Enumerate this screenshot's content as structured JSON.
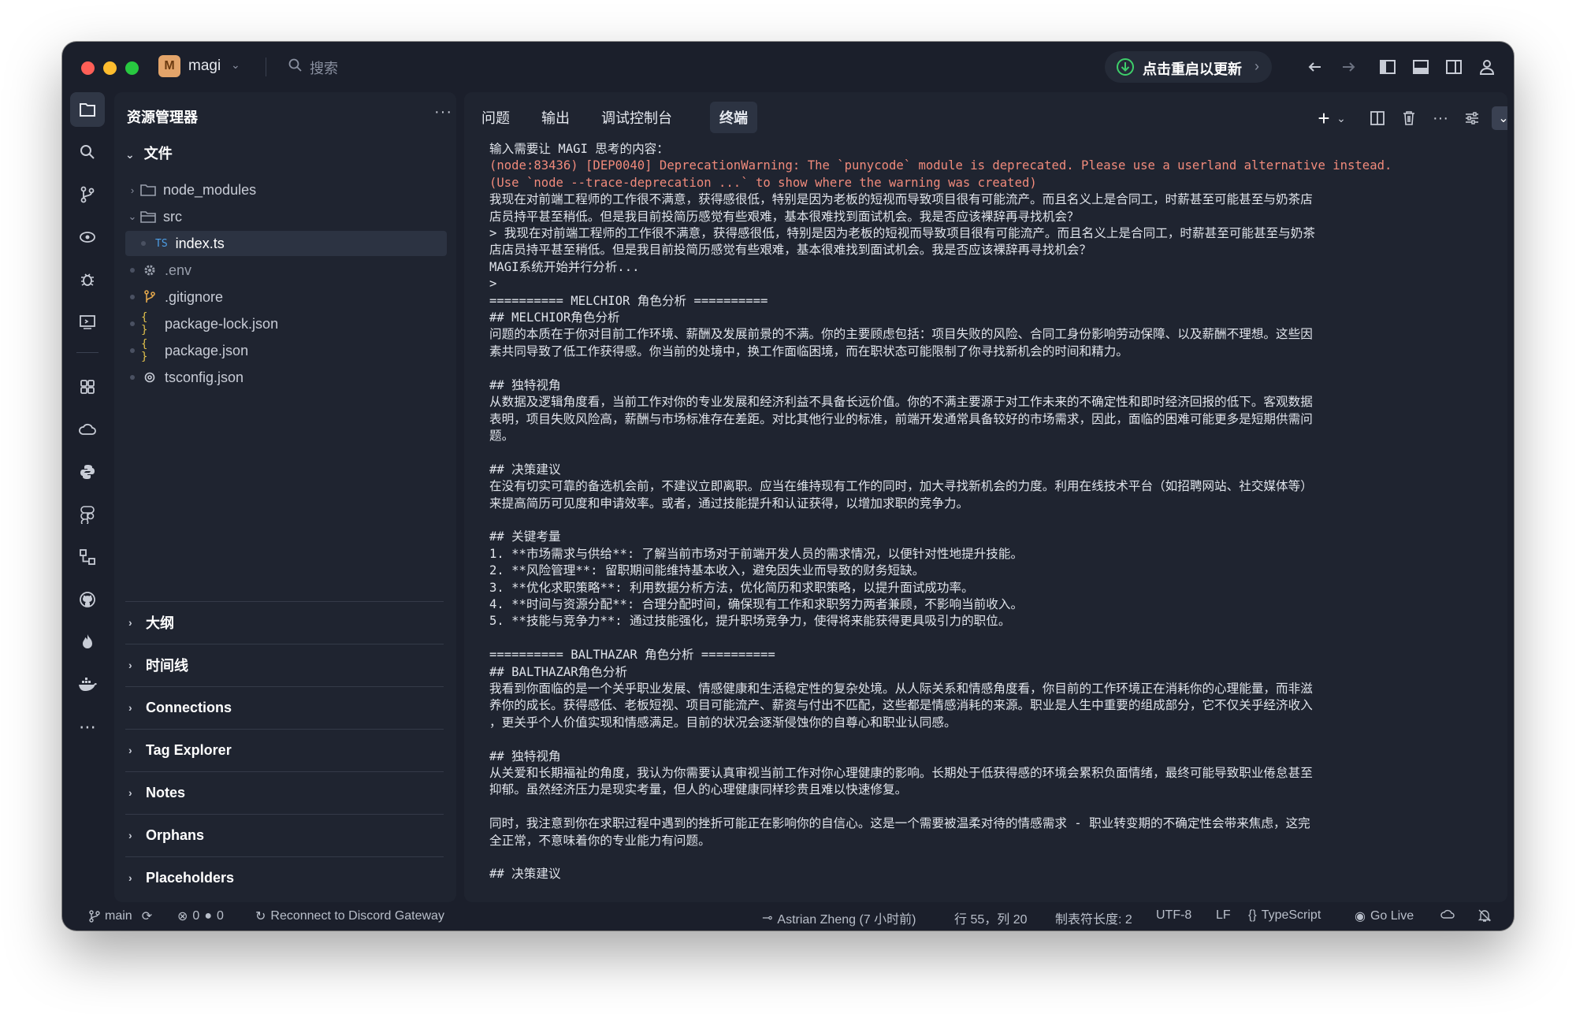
{
  "titlebar": {
    "project_initial": "M",
    "project_name": "magi",
    "search_placeholder": "搜索",
    "update_label": "点击重启以更新"
  },
  "sidebar": {
    "title": "资源管理器",
    "files_header": "文件",
    "tree": [
      {
        "label": "node_modules",
        "type": "folder",
        "expanded": false
      },
      {
        "label": "src",
        "type": "folder",
        "expanded": true
      },
      {
        "label": "index.ts",
        "type": "file-ts",
        "badge": "TS",
        "selected": true
      },
      {
        "label": ".env",
        "type": "file-env"
      },
      {
        "label": ".gitignore",
        "type": "file-git"
      },
      {
        "label": "package-lock.json",
        "type": "file-json",
        "badge": "{ }"
      },
      {
        "label": "package.json",
        "type": "file-json",
        "badge": "{ }"
      },
      {
        "label": "tsconfig.json",
        "type": "file-config"
      }
    ],
    "sections": [
      "大纲",
      "时间线",
      "Connections",
      "Tag Explorer",
      "Notes",
      "Orphans",
      "Placeholders"
    ]
  },
  "panel": {
    "tabs": [
      "问题",
      "输出",
      "调试控制台",
      "终端"
    ],
    "active_tab": "终端"
  },
  "terminal": {
    "lines": [
      "输入需要让 MAGI 思考的内容：",
      "(node:83436) [DEP0040] DeprecationWarning: The `punycode` module is deprecated. Please use a userland alternative instead.",
      "(Use `node --trace-deprecation ...` to show where the warning was created)",
      "我现在对前端工程师的工作很不满意，获得感很低，特别是因为老板的短视而导致项目很有可能流产。而且名义上是合同工，时薪甚至可能甚至与奶茶店",
      "店员持平甚至稍低。但是我目前投简历感觉有些艰难，基本很难找到面试机会。我是否应该裸辞再寻找机会？",
      "> 我现在对前端工程师的工作很不满意，获得感很低，特别是因为老板的短视而导致项目很有可能流产。而且名义上是合同工，时薪甚至可能甚至与奶茶",
      "店店员持平甚至稍低。但是我目前投简历感觉有些艰难，基本很难找到面试机会。我是否应该裸辞再寻找机会？",
      "MAGI系统开始并行分析...",
      ">",
      "========== MELCHIOR 角色分析 ==========",
      "## MELCHIOR角色分析",
      "问题的本质在于你对目前工作环境、薪酬及发展前景的不满。你的主要顾虑包括：项目失败的风险、合同工身份影响劳动保障、以及薪酬不理想。这些因",
      "素共同导致了低工作获得感。你当前的处境中，换工作面临困境，而在职状态可能限制了你寻找新机会的时间和精力。",
      "",
      "## 独特视角",
      "从数据及逻辑角度看，当前工作对你的专业发展和经济利益不具备长远价值。你的不满主要源于对工作未来的不确定性和即时经济回报的低下。客观数据",
      "表明，项目失败风险高，薪酬与市场标准存在差距。对比其他行业的标准，前端开发通常具备较好的市场需求，因此，面临的困难可能更多是短期供需问",
      "题。",
      "",
      "## 决策建议",
      "在没有切实可靠的备选机会前，不建议立即离职。应当在维持现有工作的同时，加大寻找新机会的力度。利用在线技术平台（如招聘网站、社交媒体等）",
      "来提高简历可见度和申请效率。或者，通过技能提升和认证获得，以增加求职的竞争力。",
      "",
      "## 关键考量",
      "1. **市场需求与供给**: 了解当前市场对于前端开发人员的需求情况，以便针对性地提升技能。",
      "2. **风险管理**: 留职期间能维持基本收入，避免因失业而导致的财务短缺。",
      "3. **优化求职策略**: 利用数据分析方法，优化简历和求职策略，以提升面试成功率。",
      "4. **时间与资源分配**: 合理分配时间，确保现有工作和求职努力两者兼顾，不影响当前收入。",
      "5. **技能与竞争力**: 通过技能强化，提升职场竞争力，使得将来能获得更具吸引力的职位。",
      "",
      "========== BALTHAZAR 角色分析 ==========",
      "## BALTHAZAR角色分析",
      "我看到你面临的是一个关乎职业发展、情感健康和生活稳定性的复杂处境。从人际关系和情感角度看，你目前的工作环境正在消耗你的心理能量，而非滋",
      "养你的成长。获得感低、老板短视、项目可能流产、薪资与付出不匹配，这些都是情感消耗的来源。职业是人生中重要的组成部分，它不仅关乎经济收入",
      "，更关乎个人价值实现和情感满足。目前的状况会逐渐侵蚀你的自尊心和职业认同感。",
      "",
      "## 独特视角",
      "从关爱和长期福祉的角度，我认为你需要认真审视当前工作对你心理健康的影响。长期处于低获得感的环境会累积负面情绪，最终可能导致职业倦怠甚至",
      "抑郁。虽然经济压力是现实考量，但人的心理健康同样珍贵且难以快速修复。",
      "",
      "同时，我注意到你在求职过程中遇到的挫折可能正在影响你的自信心。这是一个需要被温柔对待的情感需求 - 职业转变期的不确定性会带来焦虑，这完",
      "全正常，不意味着你的专业能力有问题。",
      "",
      "## 决策建议"
    ]
  },
  "statusbar": {
    "branch": "main",
    "errors": "0",
    "warnings": "0",
    "discord": "Reconnect to Discord Gateway",
    "blame": "Astrian Zheng (7 小时前)",
    "position": "行 55，列 20",
    "tab_size": "制表符长度: 2",
    "encoding": "UTF-8",
    "eol": "LF",
    "language": "TypeScript",
    "golive": "Go Live"
  }
}
